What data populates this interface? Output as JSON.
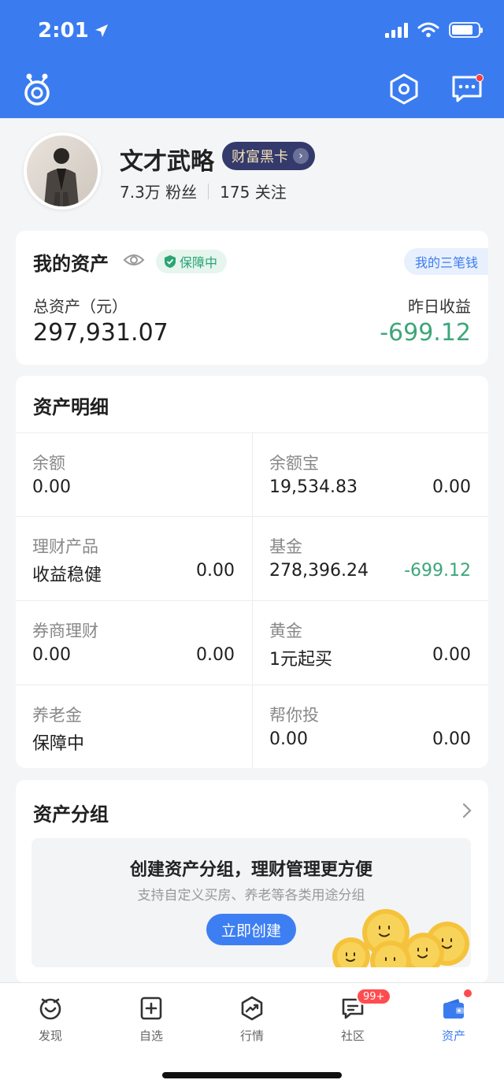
{
  "status_bar": {
    "time": "2:01"
  },
  "profile": {
    "name": "文才武略",
    "vip_label": "财富黑卡",
    "fans": "7.3万 粉丝",
    "following": "175 关注"
  },
  "my_assets": {
    "title": "我的资产",
    "safe_badge": "保障中",
    "my3_label": "我的三笔钱",
    "total_label": "总资产（元）",
    "total_value": "297,931.07",
    "yesterday_label": "昨日收益",
    "yesterday_value": "-699.12"
  },
  "detail": {
    "title": "资产明细",
    "cells": [
      {
        "name": "余额",
        "v1": "0.00",
        "v2": ""
      },
      {
        "name": "余额宝",
        "v1": "19,534.83",
        "v2": "0.00"
      },
      {
        "name": "理财产品",
        "v1": "收益稳健",
        "v2": "0.00"
      },
      {
        "name": "基金",
        "v1": "278,396.24",
        "v2": "-699.12"
      },
      {
        "name": "券商理财",
        "v1": "0.00",
        "v2": "0.00"
      },
      {
        "name": "黄金",
        "v1": "1元起买",
        "v2": "0.00"
      },
      {
        "name": "养老金",
        "v1": "保障中",
        "v2": ""
      },
      {
        "name": "帮你投",
        "v1": "0.00",
        "v2": "0.00"
      }
    ]
  },
  "group": {
    "title": "资产分组",
    "promo_title": "创建资产分组，理财管理更方便",
    "promo_sub": "支持自定义买房、养老等各类用途分组",
    "button": "立即创建"
  },
  "tabbar": {
    "items": [
      {
        "label": "发现",
        "icon": "discover-icon"
      },
      {
        "label": "自选",
        "icon": "watchlist-add-icon"
      },
      {
        "label": "行情",
        "icon": "market-trend-icon"
      },
      {
        "label": "社区",
        "icon": "community-chat-icon"
      },
      {
        "label": "资产",
        "icon": "wallet-icon"
      }
    ],
    "community_badge": "99+"
  },
  "colors": {
    "brand_blue": "#3a7cf0",
    "loss_green": "#3da67a",
    "vip_bg": "#343a6b"
  }
}
